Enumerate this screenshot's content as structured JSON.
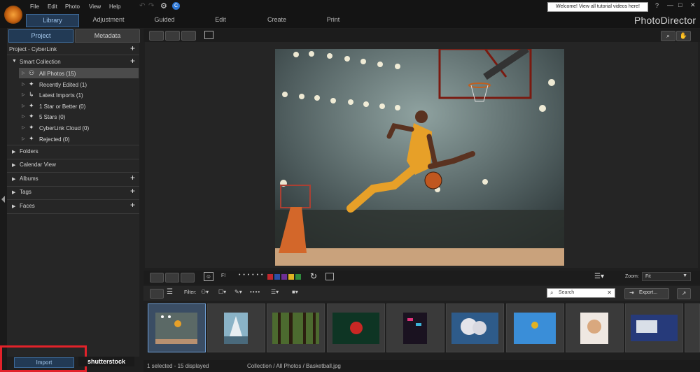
{
  "menu": [
    "File",
    "Edit",
    "Photo",
    "View",
    "Help"
  ],
  "tabs": [
    "Library",
    "Adjustment",
    "Guided",
    "Edit",
    "Create",
    "Print"
  ],
  "active_tab": "Library",
  "notice": "Welcome! View all tutorial videos here!",
  "window_controls": [
    "?",
    "—",
    "□",
    "✕"
  ],
  "brand": "PhotoDirector",
  "panel_tabs": {
    "project": "Project",
    "metadata": "Metadata"
  },
  "project_header": "Project - CyberLink",
  "smart_collection": "Smart Collection",
  "smart_items": [
    "All Photos (15)",
    "Recently Edited (1)",
    "Latest Imports (1)",
    "1 Star or Better (0)",
    "5 Stars (0)",
    "CyberLink Cloud (0)",
    "Rejected (0)"
  ],
  "sections": [
    "Folders",
    "Calendar View",
    "Albums",
    "Tags",
    "Faces"
  ],
  "import_label": "Import",
  "shutterstock_label": "shutterstock",
  "viewer_toolbar": {
    "zoom_label": "Zoom:",
    "zoom_value": "Fit",
    "flag_label": "F!"
  },
  "filter_bar": {
    "filter_label": "Filter:",
    "search_placeholder": "Search",
    "export_label": "Export..."
  },
  "color_labels": [
    "#c0272d",
    "#2d4fa5",
    "#6d2f93",
    "#e0b223",
    "#2f8a3c"
  ],
  "status": {
    "left": "1 selected - 15 displayed",
    "path": "Collection / All Photos / Basketball.jpg"
  },
  "thumbnails": [
    "basketball-player",
    "sailing-ship",
    "forest",
    "red-bird",
    "neon-street",
    "cloud-sky",
    "skateboarder",
    "smiling-woman",
    "presentation-screen"
  ]
}
